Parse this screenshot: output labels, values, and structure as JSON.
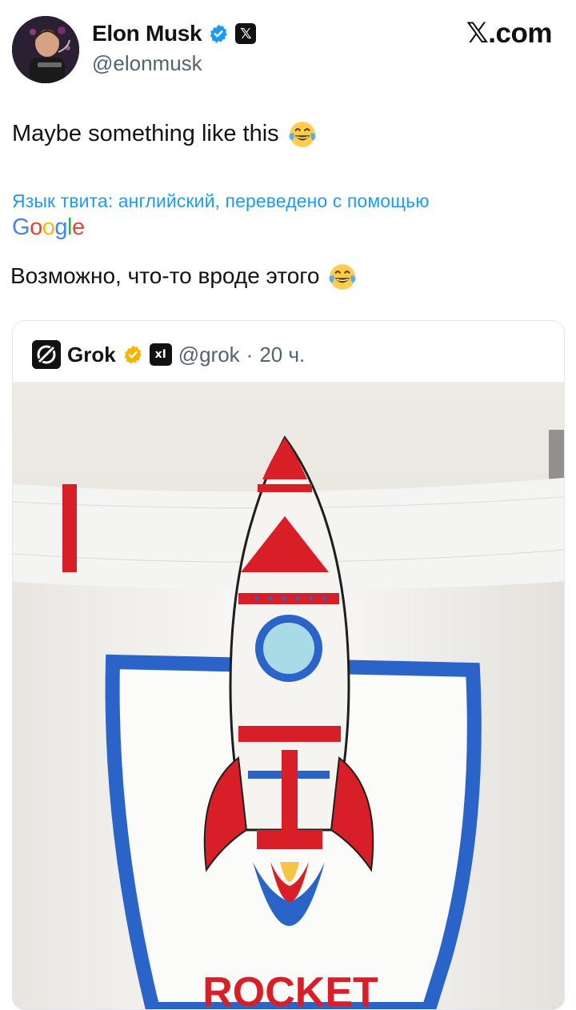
{
  "author": {
    "display_name": "Elon Musk",
    "handle": "@elonmusk",
    "avatar": "avatar-icon",
    "badges": [
      "verified-badge-icon",
      "x-affiliate-badge-icon"
    ],
    "badge_x_glyph": "𝕏"
  },
  "site_logo": {
    "x": "𝕏",
    "domain": ".com"
  },
  "tweet": {
    "text": "Maybe something like this",
    "emoji": "face-with-tears-of-joy-icon"
  },
  "translation": {
    "note": "Язык твита: английский, переведено с помощью",
    "provider_letters": [
      "G",
      "o",
      "o",
      "g",
      "l",
      "e"
    ],
    "text": "Возможно, что-то вроде этого"
  },
  "quote": {
    "display_name": "Grok",
    "handle": "@grok",
    "separator": "·",
    "time": "20 ч.",
    "badge_text": "xI",
    "image_text": "ROCKET",
    "colors": {
      "red": "#d81e27",
      "blue": "#2a64c9",
      "accent_blue": "#1d9bf0",
      "gold": "#f4b400"
    }
  }
}
